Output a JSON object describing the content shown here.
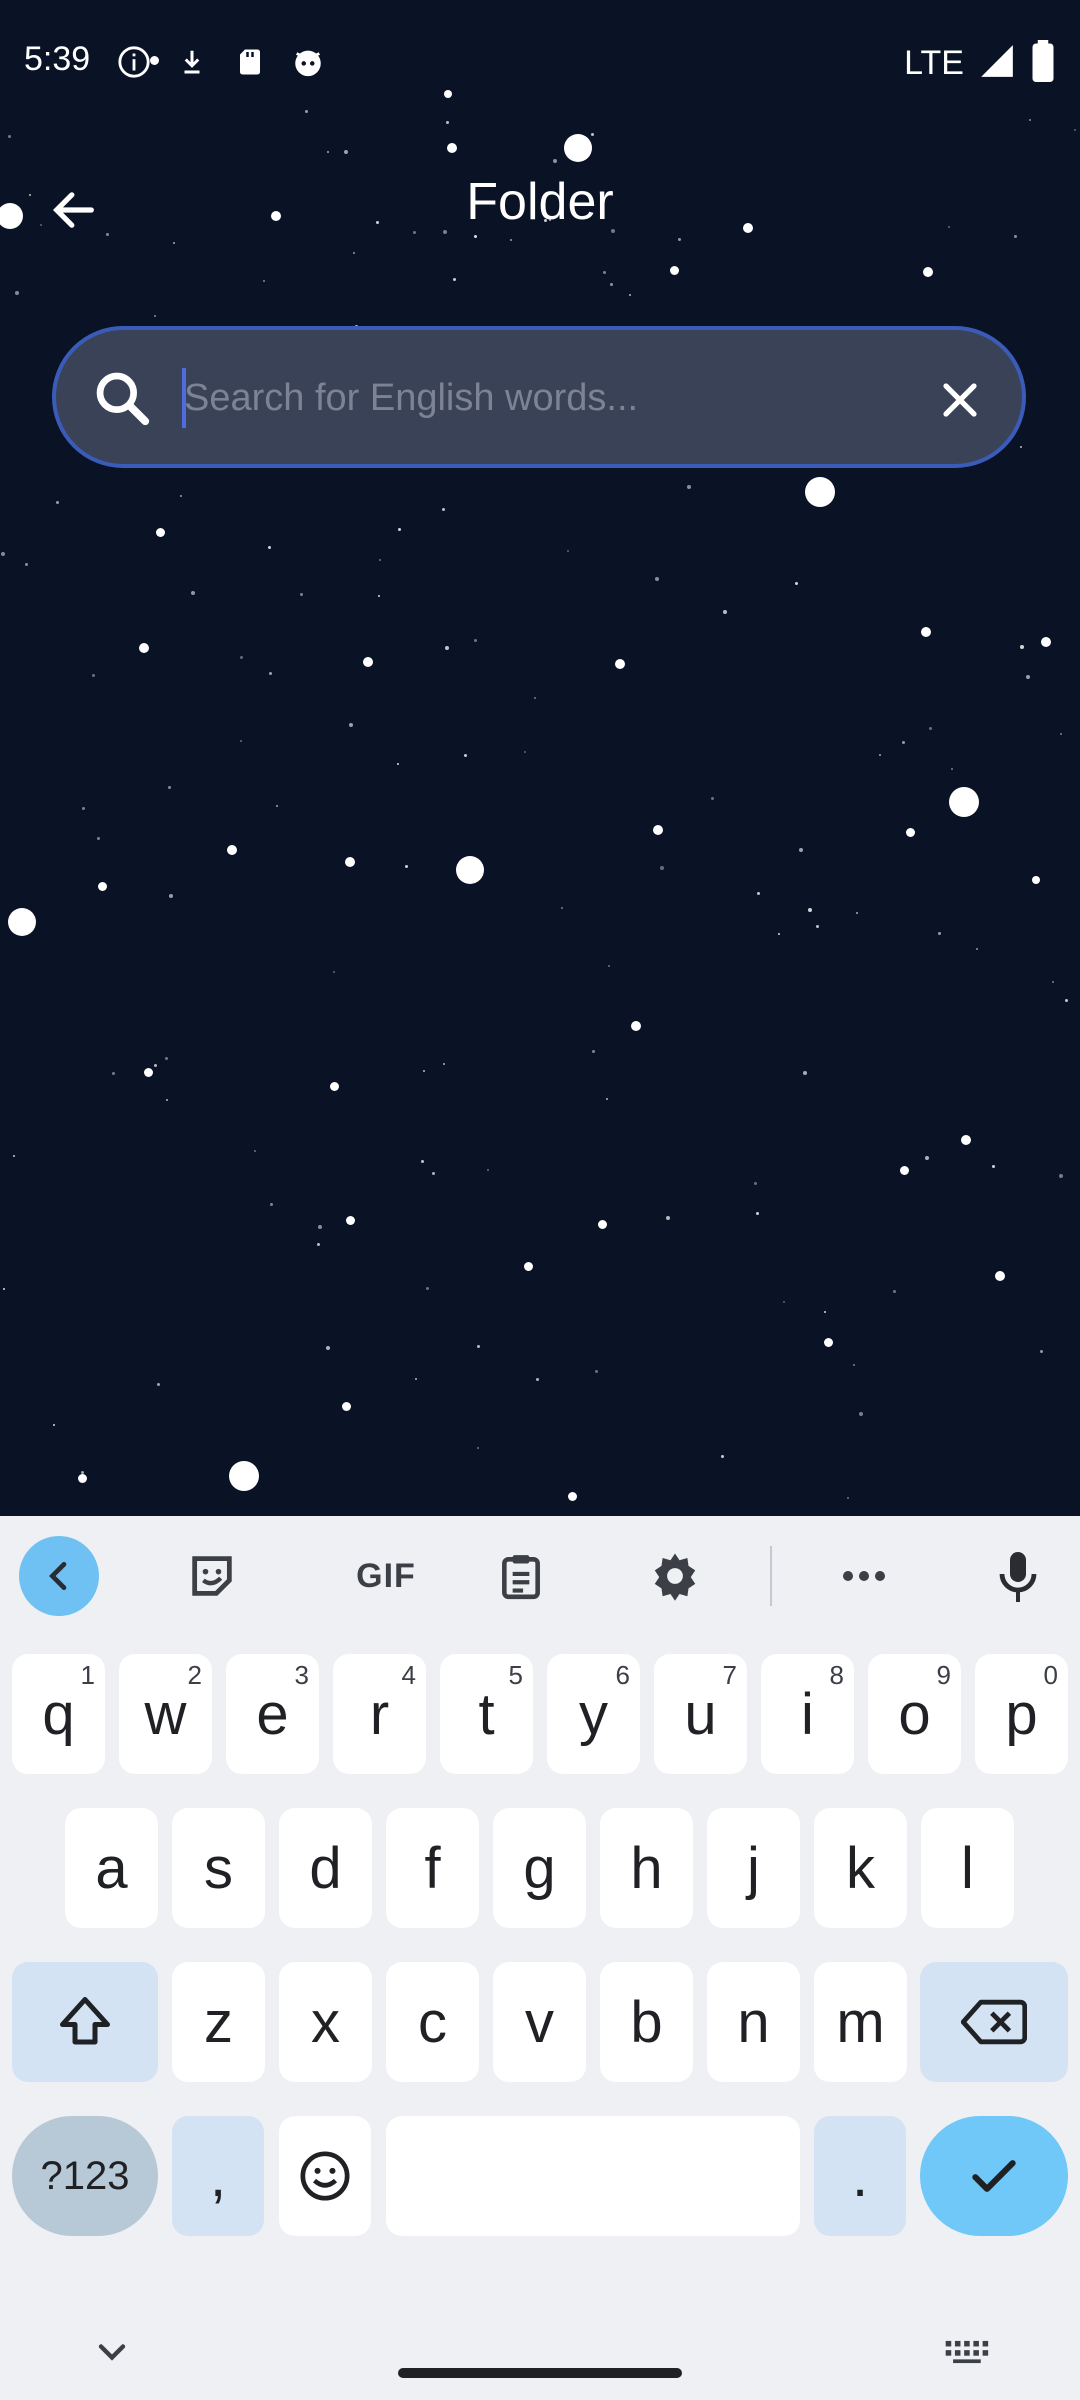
{
  "status_bar": {
    "time": "5:39",
    "network": "LTE",
    "icons_left": [
      "info-icon",
      "download-icon",
      "sd-card-icon",
      "cat-face-icon"
    ],
    "icons_right": [
      "signal-icon",
      "battery-icon"
    ]
  },
  "app_bar": {
    "title": "Folder",
    "back_icon": "arrow-left-icon"
  },
  "search": {
    "placeholder": "Search for English words...",
    "value": "",
    "icon": "search-icon",
    "clear_icon": "close-icon"
  },
  "keyboard": {
    "toolbar": {
      "collapse_icon": "chevron-left-icon",
      "sticker_icon": "sticker-icon",
      "gif_label": "GIF",
      "clipboard_icon": "clipboard-icon",
      "settings_icon": "gear-icon",
      "more_icon": "more-horizontal-icon",
      "mic_icon": "mic-icon"
    },
    "row1": [
      {
        "key": "q",
        "hint": "1"
      },
      {
        "key": "w",
        "hint": "2"
      },
      {
        "key": "e",
        "hint": "3"
      },
      {
        "key": "r",
        "hint": "4"
      },
      {
        "key": "t",
        "hint": "5"
      },
      {
        "key": "y",
        "hint": "6"
      },
      {
        "key": "u",
        "hint": "7"
      },
      {
        "key": "i",
        "hint": "8"
      },
      {
        "key": "o",
        "hint": "9"
      },
      {
        "key": "p",
        "hint": "0"
      }
    ],
    "row2": [
      "a",
      "s",
      "d",
      "f",
      "g",
      "h",
      "j",
      "k",
      "l"
    ],
    "row3": [
      "z",
      "x",
      "c",
      "v",
      "b",
      "n",
      "m"
    ],
    "row4": {
      "symbols": "?123",
      "comma": ",",
      "period": ".",
      "emoji_icon": "smiley-icon",
      "enter_icon": "checkmark-icon"
    },
    "bottom": {
      "hide_icon": "chevron-down-icon",
      "switch_icon": "keyboard-icon"
    }
  },
  "colors": {
    "background": "#0a1226",
    "search_bg": "#3a4258",
    "search_border": "#3a5cb8",
    "accent": "#6fc8f7"
  }
}
